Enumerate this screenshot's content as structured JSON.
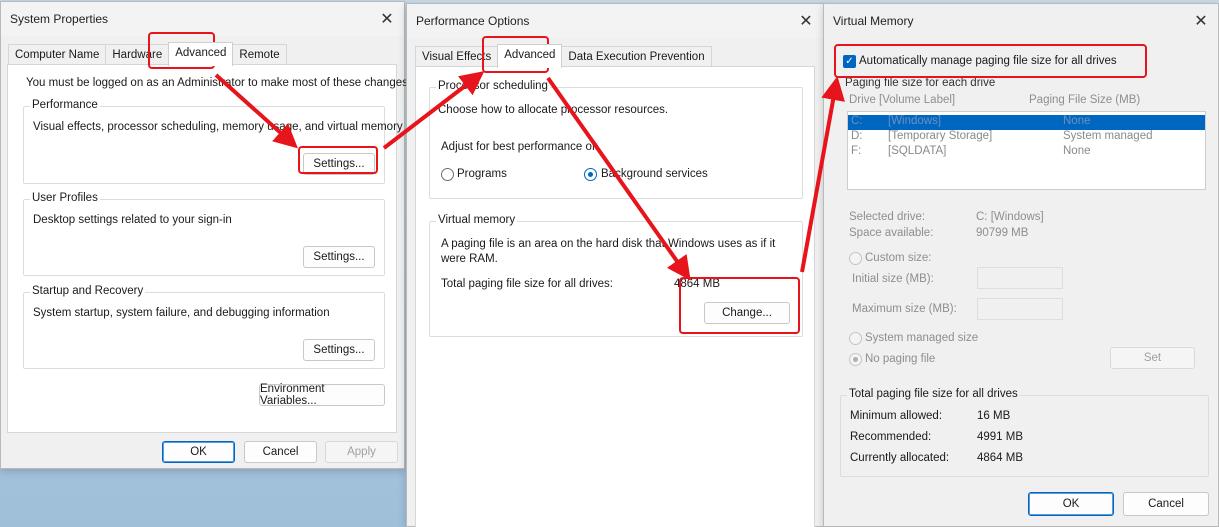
{
  "system_properties": {
    "title": "System Properties",
    "tabs": [
      "Computer Name",
      "Hardware",
      "Advanced",
      "Remote"
    ],
    "admin_note": "You must be logged on as an Administrator to make most of these changes.",
    "performance": {
      "title": "Performance",
      "description": "Visual effects, processor scheduling, memory usage, and virtual memory",
      "button": "Settings..."
    },
    "user_profiles": {
      "title": "User Profiles",
      "description": "Desktop settings related to your sign-in",
      "button": "Settings..."
    },
    "startup_recovery": {
      "title": "Startup and Recovery",
      "description": "System startup, system failure, and debugging information",
      "button": "Settings..."
    },
    "env_button": "Environment Variables...",
    "ok": "OK",
    "cancel": "Cancel",
    "apply": "Apply"
  },
  "performance_options": {
    "title": "Performance Options",
    "tabs": [
      "Visual Effects",
      "Advanced",
      "Data Execution Prevention"
    ],
    "processor": {
      "title": "Processor scheduling",
      "description": "Choose how to allocate processor resources.",
      "adjust_label": "Adjust for best performance of:",
      "option_programs": "Programs",
      "option_background": "Background services"
    },
    "virtual_memory": {
      "title": "Virtual memory",
      "description_line1": "A paging file is an area on the hard disk that Windows uses as if it",
      "description_line2": "were RAM.",
      "total_label": "Total paging file size for all drives:",
      "total_value": "4864 MB",
      "change_button": "Change..."
    }
  },
  "virtual_memory_dialog": {
    "title": "Virtual Memory",
    "auto_manage_label": "Automatically manage paging file size for all drives",
    "paging_group_title": "Paging file size for each drive",
    "col_drive": "Drive  [Volume Label]",
    "col_size": "Paging File Size (MB)",
    "drives": [
      {
        "drive": "C:",
        "label": "[Windows]",
        "size": "None"
      },
      {
        "drive": "D:",
        "label": "[Temporary Storage]",
        "size": "System managed"
      },
      {
        "drive": "F:",
        "label": "[SQLDATA]",
        "size": "None"
      }
    ],
    "selected_drive_label": "Selected drive:",
    "selected_drive_value": "C:  [Windows]",
    "space_available_label": "Space available:",
    "space_available_value": "90799 MB",
    "custom_size": "Custom size:",
    "initial_size": "Initial size (MB):",
    "maximum_size": "Maximum size (MB):",
    "system_managed": "System managed size",
    "no_paging": "No paging file",
    "set_button": "Set",
    "totals": {
      "title": "Total paging file size for all drives",
      "min_label": "Minimum allowed:",
      "min_value": "16 MB",
      "rec_label": "Recommended:",
      "rec_value": "4991 MB",
      "cur_label": "Currently allocated:",
      "cur_value": "4864 MB"
    },
    "ok": "OK",
    "cancel": "Cancel"
  },
  "colors": {
    "accent": "#0067c0",
    "annotation": "#e8141c"
  }
}
